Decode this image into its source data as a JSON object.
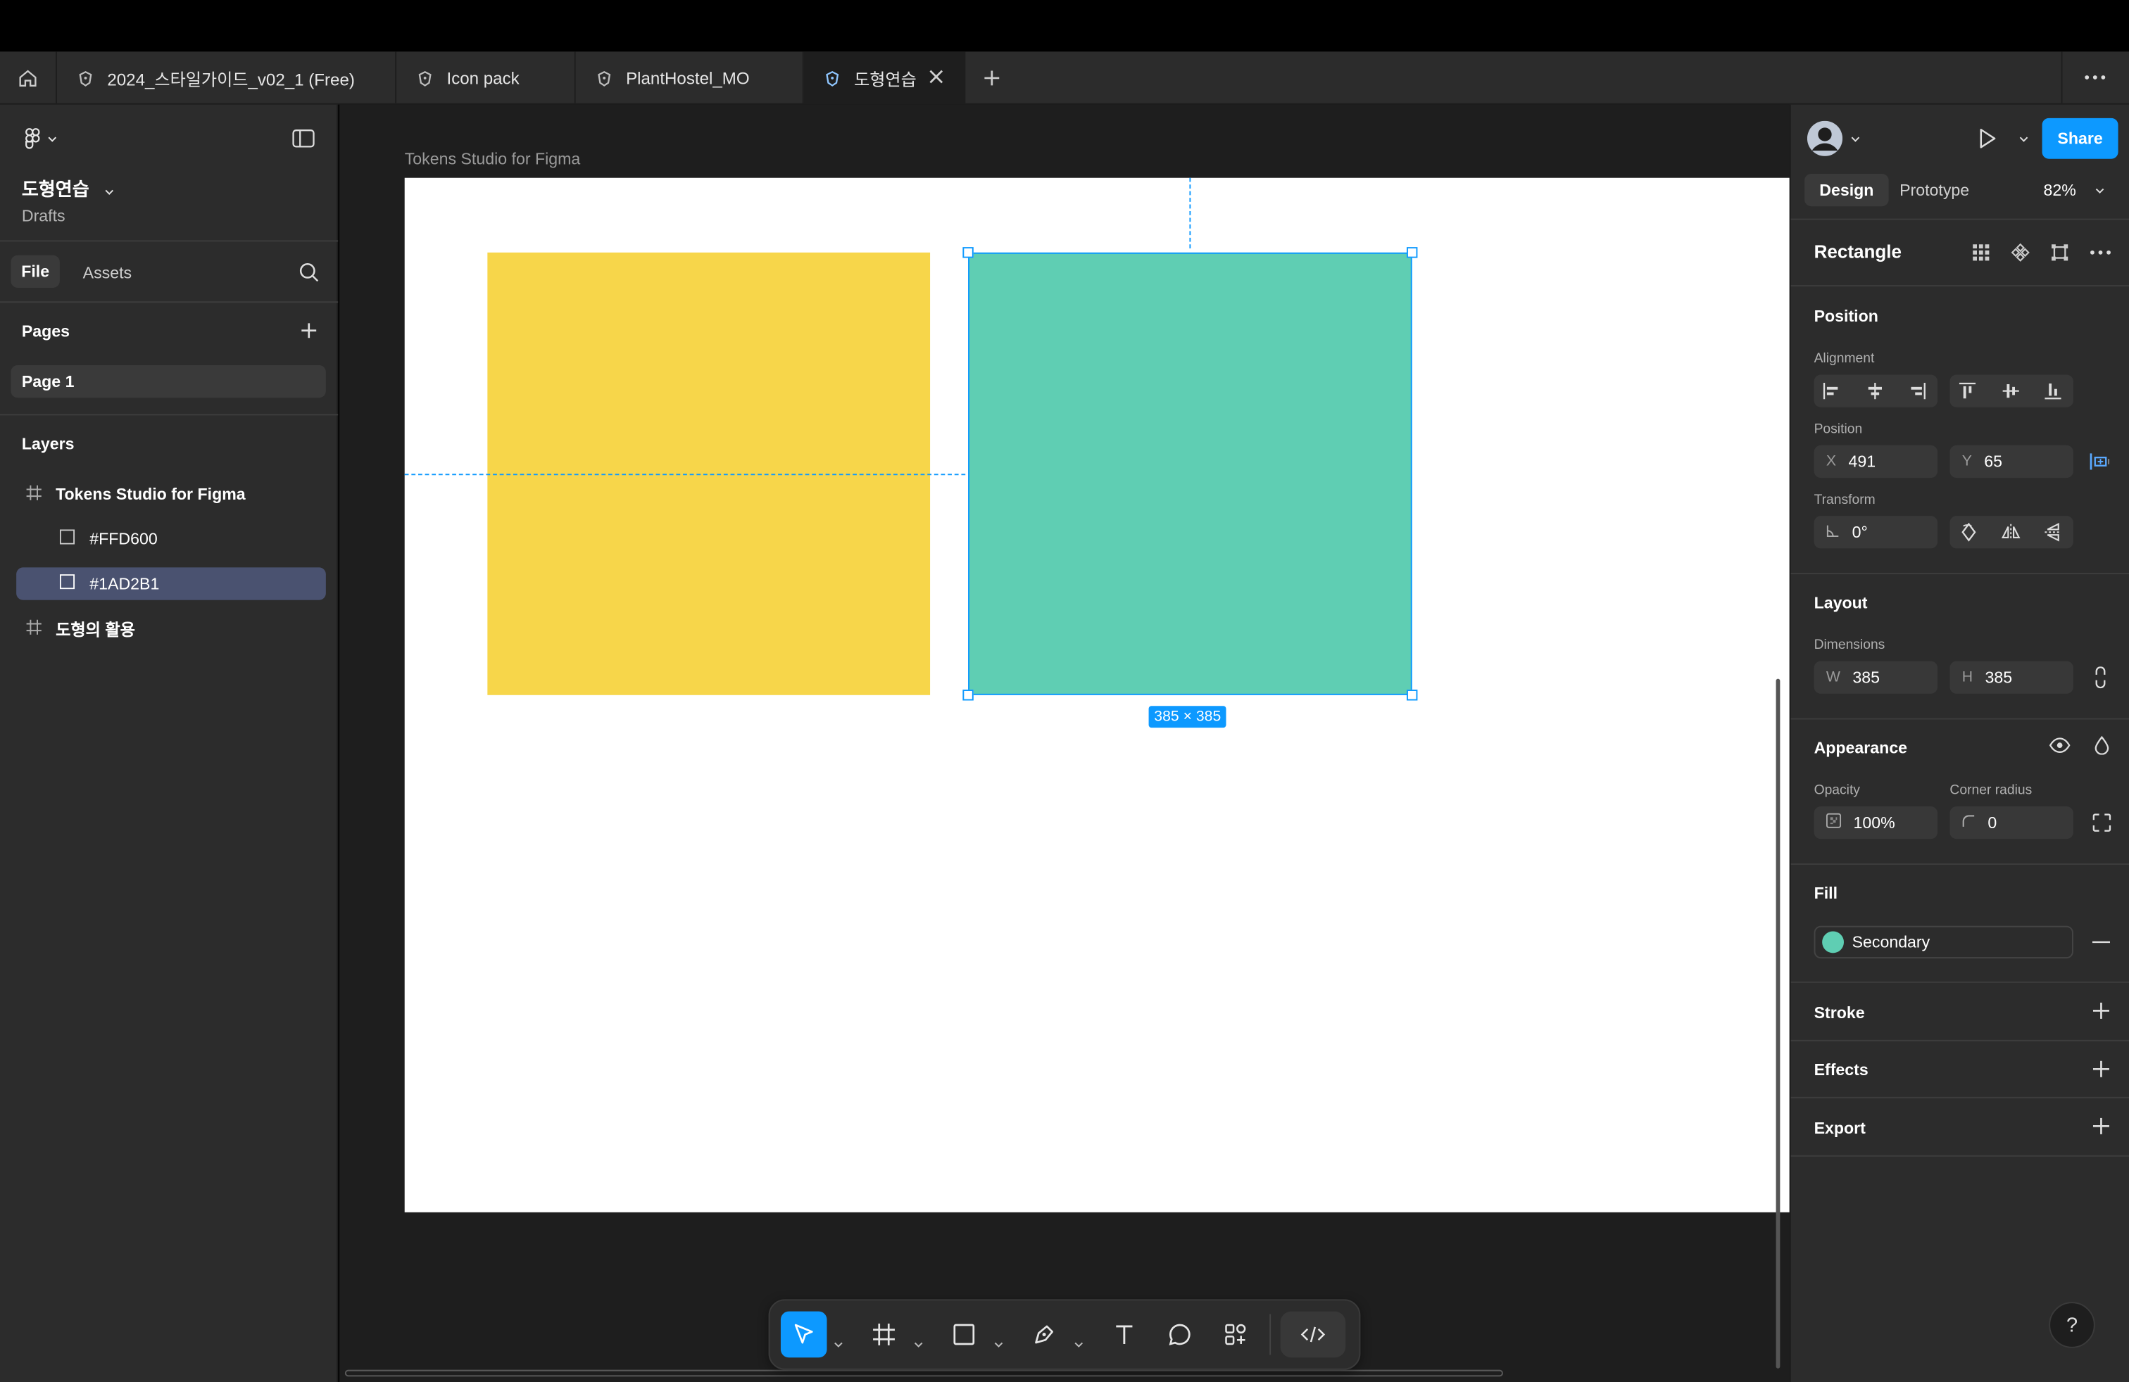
{
  "tabs": [
    {
      "label": "2024_스타일가이드_v02_1 (Free)"
    },
    {
      "label": "Icon pack"
    },
    {
      "label": "PlantHostel_MO"
    },
    {
      "label": "도형연습"
    }
  ],
  "left_panel": {
    "project_name": "도형연습",
    "project_location": "Drafts",
    "tabs": {
      "file": "File",
      "assets": "Assets"
    },
    "pages_header": "Pages",
    "pages": [
      "Page 1"
    ],
    "layers_header": "Layers",
    "layers": [
      {
        "label": "Tokens Studio for Figma",
        "type": "frame"
      },
      {
        "label": "#FFD600",
        "type": "rectangle"
      },
      {
        "label": "#1AD2B1",
        "type": "rectangle"
      },
      {
        "label": "도형의 활용",
        "type": "frame"
      }
    ]
  },
  "canvas": {
    "frame_name": "Tokens Studio for Figma",
    "yellow_color": "#F7D64A",
    "green_color": "#5FCEB3",
    "selection_size": "385 × 385"
  },
  "right_panel": {
    "share": "Share",
    "design_tab": "Design",
    "prototype_tab": "Prototype",
    "zoom": "82%",
    "object_name": "Rectangle",
    "position_section": "Position",
    "alignment_label": "Alignment",
    "position_label": "Position",
    "x_label": "X",
    "x_value": "491",
    "y_label": "Y",
    "y_value": "65",
    "transform_label": "Transform",
    "rotation": "0°",
    "layout_section": "Layout",
    "dimensions_label": "Dimensions",
    "w_label": "W",
    "w_value": "385",
    "h_label": "H",
    "h_value": "385",
    "appearance_section": "Appearance",
    "opacity_label": "Opacity",
    "opacity_value": "100%",
    "radius_label": "Corner radius",
    "radius_value": "0",
    "fill_section": "Fill",
    "fill_name": "Secondary",
    "fill_color": "#5FCEB3",
    "stroke_section": "Stroke",
    "effects_section": "Effects",
    "export_section": "Export",
    "help": "?"
  },
  "colors": {
    "accent": "#0D99FF"
  }
}
